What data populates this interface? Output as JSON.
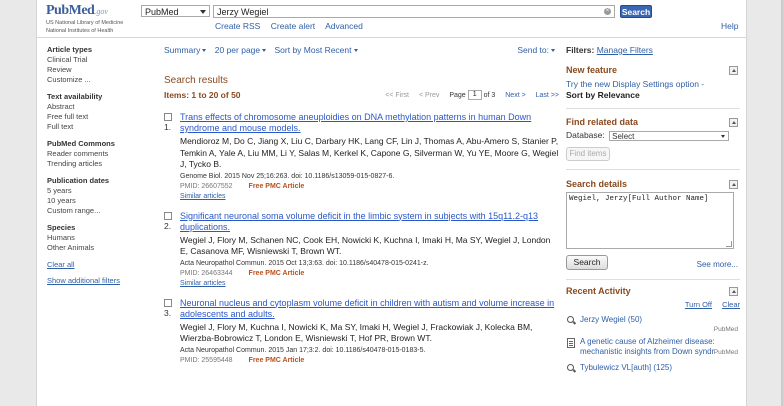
{
  "header": {
    "logo_brand": "PubMed",
    "logo_gov": ".gov",
    "logo_line1": "US National Library of Medicine",
    "logo_line2": "National Institutes of Health",
    "database": "PubMed",
    "query": "Jerzy Wegiel",
    "search_label": "Search",
    "links": [
      "Create RSS",
      "Create alert",
      "Advanced"
    ],
    "help_label": "Help"
  },
  "sidebar": {
    "facets": [
      {
        "title": "Article types",
        "items": [
          "Clinical Trial",
          "Review",
          "Customize ..."
        ]
      },
      {
        "title": "Text availability",
        "items": [
          "Abstract",
          "Free full text",
          "Full text"
        ]
      },
      {
        "title": "PubMed Commons",
        "items": [
          "Reader comments",
          "Trending articles"
        ]
      },
      {
        "title": "Publication dates",
        "items": [
          "5 years",
          "10 years",
          "Custom range..."
        ]
      },
      {
        "title": "Species",
        "items": [
          "Humans",
          "Other Animals"
        ]
      }
    ],
    "clear_all": "Clear all",
    "show_additional": "Show additional filters"
  },
  "toolbar": {
    "summary": "Summary",
    "per_page": "20 per page",
    "sort": "Sort by Most Recent",
    "send_to": "Send to:"
  },
  "results": {
    "heading": "Search results",
    "items_line": "Items: 1 to 20 of 50",
    "pager": {
      "first": "<< First",
      "prev": "< Prev",
      "page_label": "Page",
      "page": "1",
      "of": "of 3",
      "next": "Next >",
      "last": "Last >>"
    },
    "list": [
      {
        "num": "1.",
        "title": "Trans effects of chromosome aneuploidies on DNA methylation patterns in human Down syndrome and mouse models.",
        "authors": "Mendioroz M, Do C, Jiang X, Liu C, Darbary HK, Lang CF, Lin J, Thomas A, Abu-Amero S, Stanier P, Temkin A, Yale A, Liu MM, Li Y, Salas M, Kerkel K, Capone G, Silverman W, Yu YE, Moore G, Wegiel J, Tycko B.",
        "journal": "Genome Biol. 2015 Nov 25;16:263. doi: 10.1186/s13059-015-0827-6.",
        "pmid": "PMID: 26607552",
        "free": "Free PMC Article",
        "similar": "Similar articles"
      },
      {
        "num": "2.",
        "title": "Significant neuronal soma volume deficit in the limbic system in subjects with 15q11.2-q13 duplications.",
        "authors": "Wegiel J, Flory M, Schanen NC, Cook EH, Nowicki K, Kuchna I, Imaki H, Ma SY, Wegiel J, London E, Casanova MF, Wisniewski T, Brown WT.",
        "journal": "Acta Neuropathol Commun. 2015 Oct 13;3:63. doi: 10.1186/s40478-015-0241-z.",
        "pmid": "PMID: 26463344",
        "free": "Free PMC Article",
        "similar": "Similar articles"
      },
      {
        "num": "3.",
        "title": "Neuronal nucleus and cytoplasm volume deficit in children with autism and volume increase in adolescents and adults.",
        "authors": "Wegiel J, Flory M, Kuchna I, Nowicki K, Ma SY, Imaki H, Wegiel J, Frackowiak J, Kolecka BM, Wierzba-Bobrowicz T, London E, Wisniewski T, Hof PR, Brown WT.",
        "journal": "Acta Neuropathol Commun. 2015 Jan 17;3:2. doi: 10.1186/s40478-015-0183-5.",
        "pmid": "PMID: 25595448",
        "free": "Free PMC Article",
        "similar": "Similar articles"
      }
    ]
  },
  "right": {
    "filters_label": "Filters:",
    "manage_filters": "Manage Filters",
    "new_feature": {
      "title": "New feature",
      "text": "Try the new Display Settings option -",
      "bold": "Sort by Relevance"
    },
    "related": {
      "title": "Find related data",
      "db_label": "Database:",
      "db_value": "Select",
      "find_label": "Find items"
    },
    "search_details": {
      "title": "Search details",
      "query": "Wegiel, Jerzy[Full Author Name]",
      "search_label": "Search",
      "see_more": "See more..."
    },
    "recent": {
      "title": "Recent Activity",
      "turn_off": "Turn Off",
      "clear": "Clear",
      "items": [
        {
          "text": "Jerzy Wegiel (50)",
          "src": "PubMed",
          "icon": "magnifier-icon"
        },
        {
          "text": "A genetic cause of Alzheimer disease: mechanistic insights from Down syndr",
          "src": "PubMed",
          "icon": "document-icon"
        },
        {
          "text": "Tybulewicz VL[auth] (125)",
          "src": "",
          "icon": "magnifier-icon"
        }
      ]
    }
  }
}
